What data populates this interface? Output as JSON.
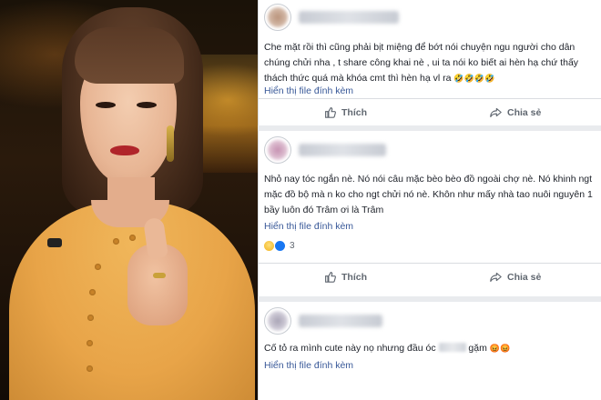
{
  "posts": [
    {
      "comment_text": "Che mặt rồi thì cũng phải bịt miệng để bớt nói chuyện ngu người cho dân chúng chửi nha , t share công khai nè , ui ta nói ko biết ai hèn hạ chứ thấy thách thức quá mà khóa cmt thì hèn hạ vl ra",
      "emoji_tail": "🤣🤣🤣🤣",
      "attachment_label": "Hiển thị file đính kèm",
      "like_label": "Thích",
      "share_label": "Chia sẻ"
    },
    {
      "comment_text": "Nhỏ nay tóc ngắn nè. Nó nói câu mặc bèo bèo đồ ngoài chợ nè. Nó khinh ngt mặc đồ bộ mà n ko cho ngt chửi nó nè. Khôn như mấy nhà tao nuôi nguyên 1 bầy luôn đó Trâm ơi là Trâm",
      "attachment_label": "Hiển thị file đính kèm",
      "reaction_count": "3",
      "like_label": "Thích",
      "share_label": "Chia sẻ"
    },
    {
      "comment_before": "Cố tỏ ra mình cute này nọ nhưng đầu óc",
      "comment_after": "gặm",
      "emoji_tail": "😡😡",
      "attachment_label": "Hiển thị file đính kèm"
    }
  ],
  "icons": [
    "thumbs-up-icon",
    "share-arrow-icon",
    "haha-reaction-icon",
    "like-reaction-icon",
    "laugh-emoji-icon",
    "angry-emoji-icon"
  ],
  "colors": {
    "link": "#385898",
    "text": "#1d2129",
    "muted": "#606770",
    "separator": "#e9ebee",
    "like_blue": "#1877f2"
  }
}
